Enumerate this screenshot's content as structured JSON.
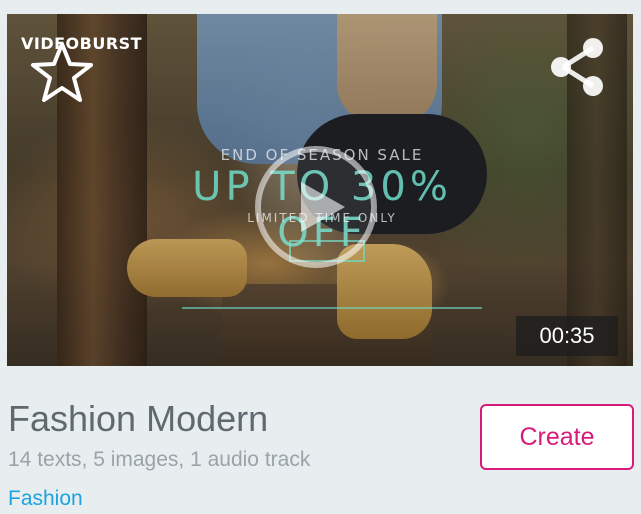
{
  "thumbnail": {
    "brand_logo_text": "VIDEOBURST",
    "promo": {
      "line1": "END OF SEASON SALE",
      "line2": "UP TO 30% OFF",
      "line3": "LIMITED TIME ONLY"
    },
    "duration": "00:35",
    "icons": {
      "favorite": "star-outline-icon",
      "share": "share-icon",
      "play": "play-icon"
    }
  },
  "template": {
    "title": "Fashion Modern",
    "details": "14 texts, 5 images, 1 audio track",
    "category": "Fashion"
  },
  "actions": {
    "create_label": "Create"
  },
  "colors": {
    "background": "#e8edf0",
    "title": "#5f6a70",
    "details": "#9aa3a8",
    "category_link": "#1aa3e0",
    "create_accent": "#d81b7a",
    "promo_teal": "#6edcc8"
  }
}
